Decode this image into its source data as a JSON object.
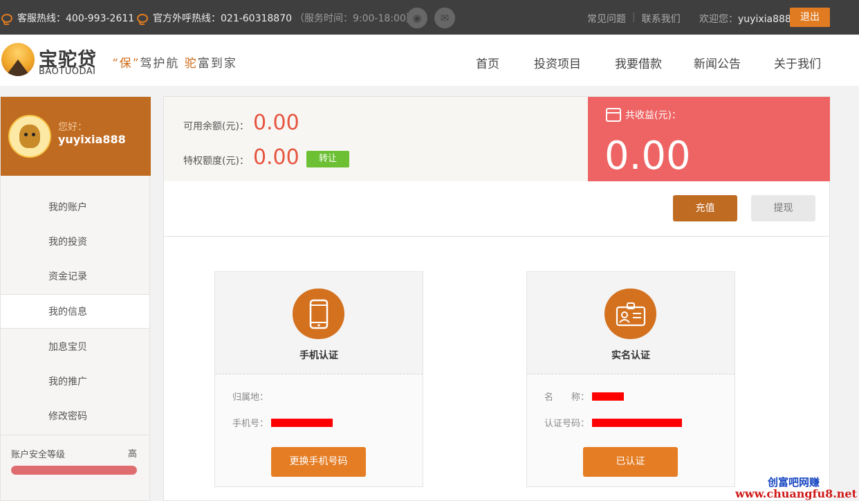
{
  "topbar": {
    "hotline_label": "客服热线：400-993-2611",
    "official_label": "官方外呼热线：021-60318870",
    "service_hours": "（服务时间：9:00-18:00）",
    "faq": "常见问题",
    "contact": "联系我们",
    "welcome": "欢迎您：",
    "username": "yuyixia888",
    "logout": "退出"
  },
  "header": {
    "logo_cn": "宝驼贷",
    "logo_en": "BAOTUODAI",
    "slogan_quote": "“保”",
    "slogan_mid": "驾护航",
    "slogan_tuo": "驼",
    "slogan_end": "富到家",
    "nav": [
      "首页",
      "投资项目",
      "我要借款",
      "新闻公告",
      "关于我们"
    ]
  },
  "sidebar": {
    "greeting": "您好：",
    "username": "yuyixia888",
    "menu": [
      "我的账户",
      "我的投资",
      "资金记录",
      "我的信息",
      "加息宝贝",
      "我的推广",
      "修改密码"
    ],
    "active_index": 3,
    "security_label": "账户安全等级",
    "security_level": "高",
    "security_fill": 1.0,
    "security_color": "#df6d70"
  },
  "account": {
    "available_label": "可用余额(元)：",
    "available_value": "0.00",
    "privilege_label": "特权额度(元)：",
    "privilege_value": "0.00",
    "transfer_button": "转让",
    "earnings_label": "共收益(元)：",
    "earnings_value": "0.00",
    "recharge_button": "充值",
    "withdraw_button": "提现"
  },
  "cards": {
    "phone": {
      "title": "手机认证",
      "location_label": "归属地：",
      "number_label": "手机号：",
      "button": "更换手机号码",
      "icon": "phone-icon"
    },
    "realname": {
      "title": "实名认证",
      "name_label": "名　　称：",
      "id_label": "认证号码：",
      "button": "已认证",
      "icon": "id-card-icon"
    }
  },
  "watermark": {
    "line1": "创富吧网赚",
    "line2": "www.chuangfu8.net"
  },
  "colors": {
    "accent": "#e07b22",
    "sidebar_header": "#c06b22",
    "earnings_bg": "#ee6363",
    "balance_red": "#e6543f",
    "transfer_green": "#6dc034"
  }
}
